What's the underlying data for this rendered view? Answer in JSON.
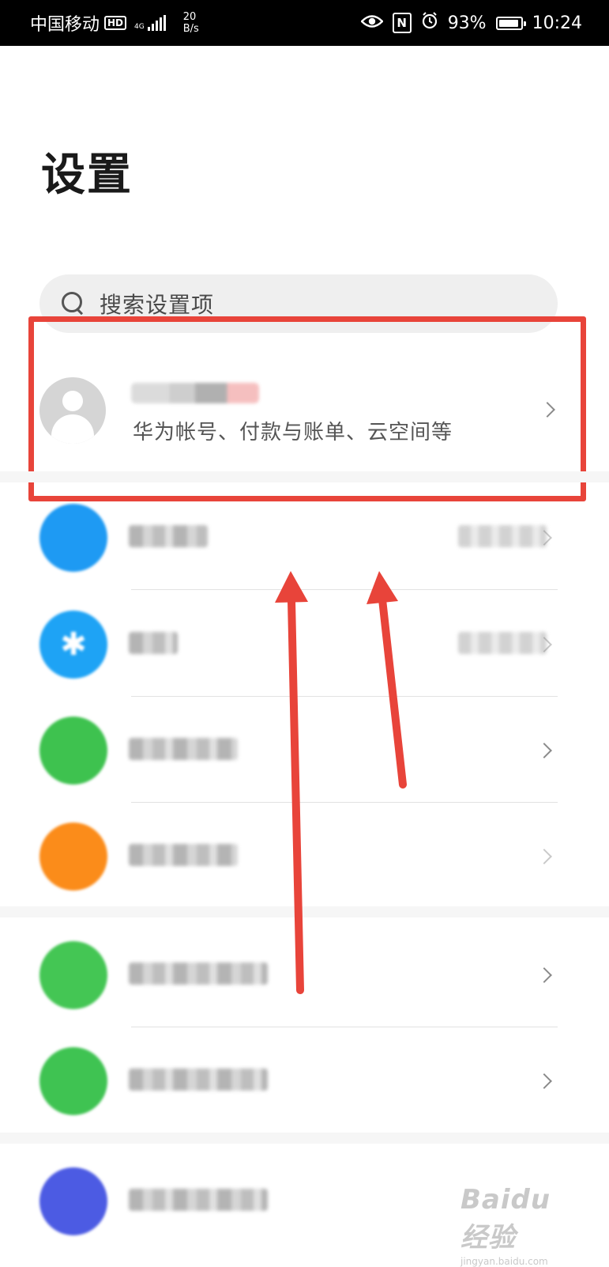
{
  "status_bar": {
    "carrier": "中国移动",
    "hd_badge": "HD",
    "network": "4G",
    "speed_value": "20",
    "speed_unit": "B/s",
    "battery_percent": "93%",
    "battery_level": 0.93,
    "time": "10:24",
    "icons": [
      "eye-icon",
      "nfc-icon",
      "alarm-icon",
      "battery-icon"
    ]
  },
  "page": {
    "title": "设置"
  },
  "search": {
    "placeholder": "搜索设置项"
  },
  "account": {
    "subtitle": "华为帐号、付款与账单、云空间等"
  },
  "settings_items": [
    {
      "icon": "wifi-icon",
      "color": "#1e9af3"
    },
    {
      "icon": "bluetooth-icon",
      "color": "#1ea3f5",
      "glyph": "✱"
    },
    {
      "icon": "mobile-network-icon",
      "color": "#3ec24f"
    },
    {
      "icon": "more-connections-icon",
      "color": "#fb8c1a"
    },
    {
      "icon": "home-screen-wallpaper-icon",
      "color": "#44c654"
    },
    {
      "icon": "display-brightness-icon",
      "color": "#3fc352"
    },
    {
      "icon": "notifications-icon",
      "color": "#4c5be3"
    }
  ],
  "annotation": {
    "color": "#e8443a"
  },
  "watermark": {
    "text": "Baidu经验",
    "subtext": "jingyan.baidu.com"
  }
}
